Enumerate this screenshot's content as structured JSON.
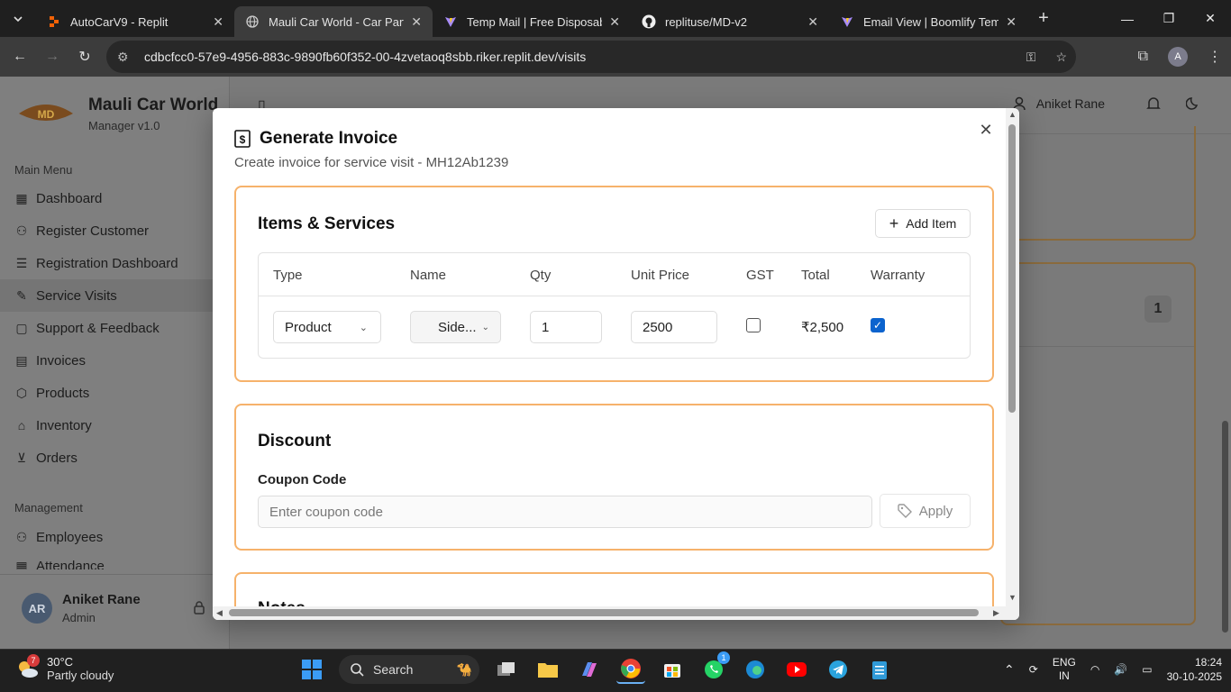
{
  "browser": {
    "tabs": [
      {
        "title": "AutoCarV9 - Replit",
        "active": false
      },
      {
        "title": "Mauli Car World - Car Parts &",
        "active": true
      },
      {
        "title": "Temp Mail | Free Disposable",
        "active": false
      },
      {
        "title": "replituse/MD-v2",
        "active": false
      },
      {
        "title": "Email View | Boomlify Tempo",
        "active": false
      }
    ],
    "url": "cdbcfcc0-57e9-4956-883c-9890fb60f352-00-4zvetaoq8sbb.riker.replit.dev/visits",
    "profile_initial": "A"
  },
  "app": {
    "brand_name": "Mauli Car World",
    "brand_version": "Manager v1.0",
    "main_menu_header": "Main Menu",
    "main_menu": [
      {
        "label": "Dashboard",
        "icon": "grid-icon"
      },
      {
        "label": "Register Customer",
        "icon": "user-plus-icon"
      },
      {
        "label": "Registration Dashboard",
        "icon": "list-icon"
      },
      {
        "label": "Service Visits",
        "icon": "wrench-icon",
        "selected": true
      },
      {
        "label": "Support & Feedback",
        "icon": "message-icon"
      },
      {
        "label": "Invoices",
        "icon": "file-icon"
      },
      {
        "label": "Products",
        "icon": "package-icon"
      },
      {
        "label": "Inventory",
        "icon": "warehouse-icon"
      },
      {
        "label": "Orders",
        "icon": "cart-icon"
      }
    ],
    "management_header": "Management",
    "management_menu": [
      {
        "label": "Employees",
        "icon": "users-icon"
      },
      {
        "label": "Attendance",
        "icon": "calendar-icon"
      }
    ],
    "user": {
      "initials": "AR",
      "name": "Aniket Rane",
      "role": "Admin"
    },
    "topbar_user": "Aniket Rane",
    "background_badge": "1"
  },
  "modal": {
    "title": "Generate Invoice",
    "subtitle": "Create invoice for service visit - MH12Ab1239",
    "items_section": {
      "title": "Items & Services",
      "add_button": "Add Item",
      "columns": [
        "Type",
        "Name",
        "Qty",
        "Unit Price",
        "GST",
        "Total",
        "Warranty"
      ],
      "rows": [
        {
          "type": "Product",
          "name": "Side...",
          "qty": "1",
          "unit_price": "2500",
          "gst": false,
          "total": "₹2,500",
          "warranty": true
        }
      ]
    },
    "discount_section": {
      "title": "Discount",
      "coupon_label": "Coupon Code",
      "coupon_placeholder": "Enter coupon code",
      "apply_button": "Apply"
    },
    "notes_section": {
      "title": "Notes"
    }
  },
  "taskbar": {
    "weather_temp": "30°C",
    "weather_desc": "Partly cloudy",
    "weather_badge": "7",
    "search_label": "Search",
    "lang_line1": "ENG",
    "lang_line2": "IN",
    "time": "18:24",
    "date": "30-10-2025",
    "whatsapp_badge": "1"
  }
}
